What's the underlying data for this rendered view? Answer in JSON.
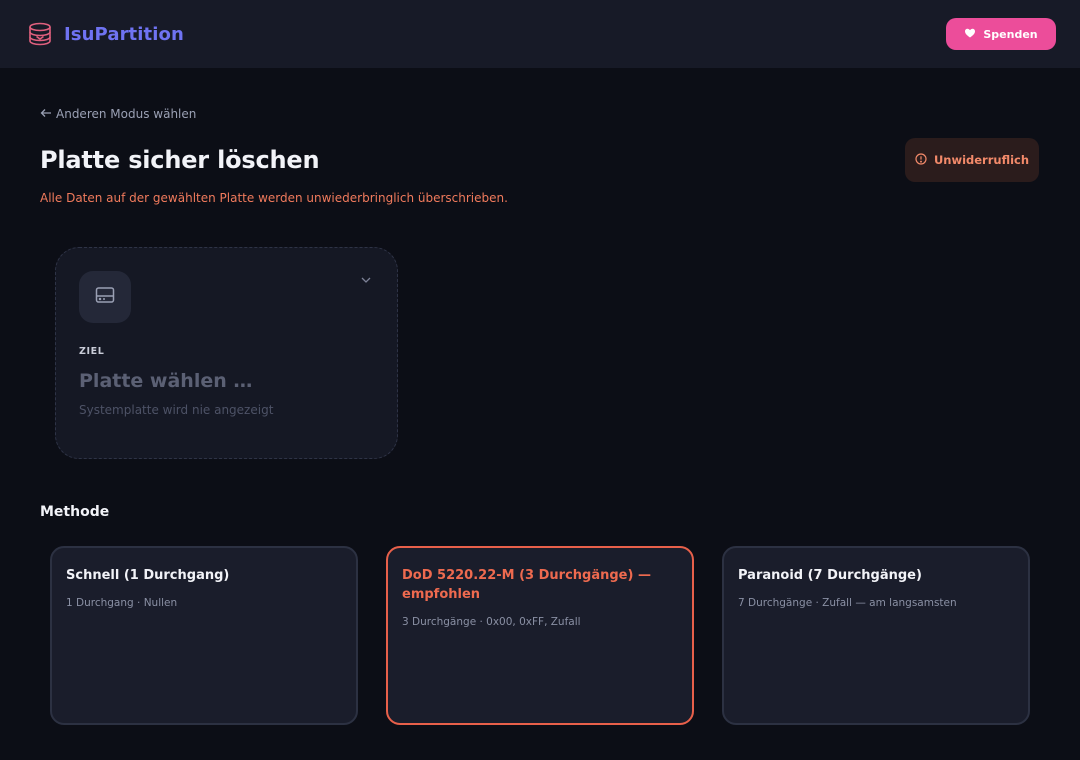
{
  "app": {
    "name": "IsuPartition"
  },
  "header": {
    "donate_label": "Spenden"
  },
  "nav": {
    "back_label": "Anderen Modus wählen"
  },
  "page": {
    "title": "Platte sicher löschen",
    "subtitle": "Alle Daten auf der gewählten Platte werden unwiederbringlich überschrieben.",
    "badge": "Unwiderruflich"
  },
  "target": {
    "label": "ZIEL",
    "placeholder": "Platte wählen …",
    "hint": "Systemplatte wird nie angezeigt"
  },
  "methods": {
    "title": "Methode",
    "items": [
      {
        "name": "Schnell (1 Durchgang)",
        "desc": "1 Durchgang · Nullen",
        "selected": false
      },
      {
        "name": "DoD 5220.22-M (3 Durchgänge) — empfohlen",
        "desc": "3 Durchgänge · 0x00, 0xFF, Zufall",
        "selected": true
      },
      {
        "name": "Paranoid (7 Durchgänge)",
        "desc": "7 Durchgänge · Zufall — am langsamsten",
        "selected": false
      }
    ]
  },
  "colors": {
    "brand": "#6f73f2",
    "donate": "#ec4d9a",
    "danger": "#ee6a4f",
    "background": "#0c0e16",
    "header": "#171a27"
  },
  "icons": {
    "logo": "stacked-disks-icon",
    "donate": "heart-hand-icon",
    "back": "arrow-left-icon",
    "warning": "alert-circle-icon",
    "disk": "hard-drive-icon",
    "chevron": "chevron-down-icon"
  }
}
